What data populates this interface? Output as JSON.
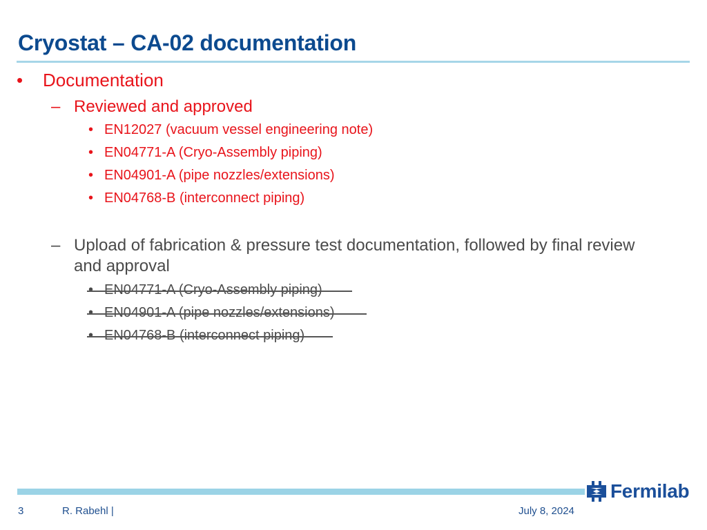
{
  "slide": {
    "title": "Cryostat – CA-02 documentation",
    "content": {
      "level1": {
        "bullet": "•",
        "text": "Documentation"
      },
      "reviewed": {
        "dash": "–",
        "text": "Reviewed and approved",
        "items": [
          {
            "bullet": "•",
            "text": "EN12027 (vacuum vessel engineering note)"
          },
          {
            "bullet": "•",
            "text": "EN04771-A (Cryo-Assembly piping)"
          },
          {
            "bullet": "•",
            "text": "EN04901-A (pipe nozzles/extensions)"
          },
          {
            "bullet": "•",
            "text": "EN04768-B (interconnect piping)"
          }
        ]
      },
      "upload": {
        "dash": "–",
        "text_line1": "Upload of fabrication & pressure test documentation, followed by final review",
        "text_line2": "and approval",
        "items": [
          {
            "bullet": "•",
            "text": "EN04771-A (Cryo-Assembly piping)",
            "struck": true
          },
          {
            "bullet": "•",
            "text": "EN04901-A (pipe nozzles/extensions)",
            "struck": true
          },
          {
            "bullet": "•",
            "text": "EN04768-B (interconnect piping)",
            "struck": true
          }
        ]
      }
    }
  },
  "footer": {
    "page_number": "3",
    "author": "R. Rabehl |",
    "date": "July 8, 2024",
    "logo_text": "Fermilab"
  },
  "colors": {
    "title": "#0c4a8f",
    "accent_red": "#e8141b",
    "rule": "#a6d6e8",
    "footer_bar": "#9bd3e6",
    "logo": "#1b4f9a"
  }
}
